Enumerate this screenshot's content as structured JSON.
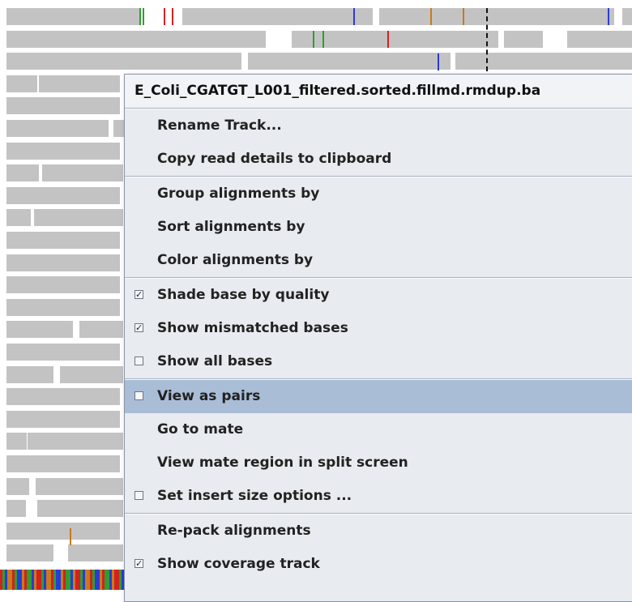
{
  "menu": {
    "title": "E_Coli_CGATGT_L001_filtered.sorted.fillmd.rmdup.ba",
    "sections": [
      [
        {
          "label": "Rename Track...",
          "checkbox": null
        },
        {
          "label": "Copy read details to clipboard",
          "checkbox": null
        }
      ],
      [
        {
          "label": "Group alignments by",
          "checkbox": null
        },
        {
          "label": "Sort alignments by",
          "checkbox": null
        },
        {
          "label": "Color alignments by",
          "checkbox": null
        }
      ],
      [
        {
          "label": "Shade base by quality",
          "checkbox": true
        },
        {
          "label": "Show mismatched bases",
          "checkbox": true
        },
        {
          "label": "Show all bases",
          "checkbox": false
        }
      ],
      [
        {
          "label": "View as pairs",
          "checkbox": false,
          "highlighted": true
        },
        {
          "label": "Go to mate",
          "checkbox": null
        },
        {
          "label": "View mate region in split screen",
          "checkbox": null
        },
        {
          "label": "Set insert size options ...",
          "checkbox": false
        }
      ],
      [
        {
          "label": "Re-pack alignments",
          "checkbox": null
        },
        {
          "label": "Show coverage track",
          "checkbox": true
        }
      ]
    ]
  },
  "colors": {
    "read_gray": "#c3c3c3",
    "menu_bg": "#e8ebef",
    "highlight": "#a9bdd6",
    "base_A": "#2f9e2f",
    "base_C": "#2b3bd8",
    "base_G": "#c77b1a",
    "base_T": "#d42020"
  }
}
